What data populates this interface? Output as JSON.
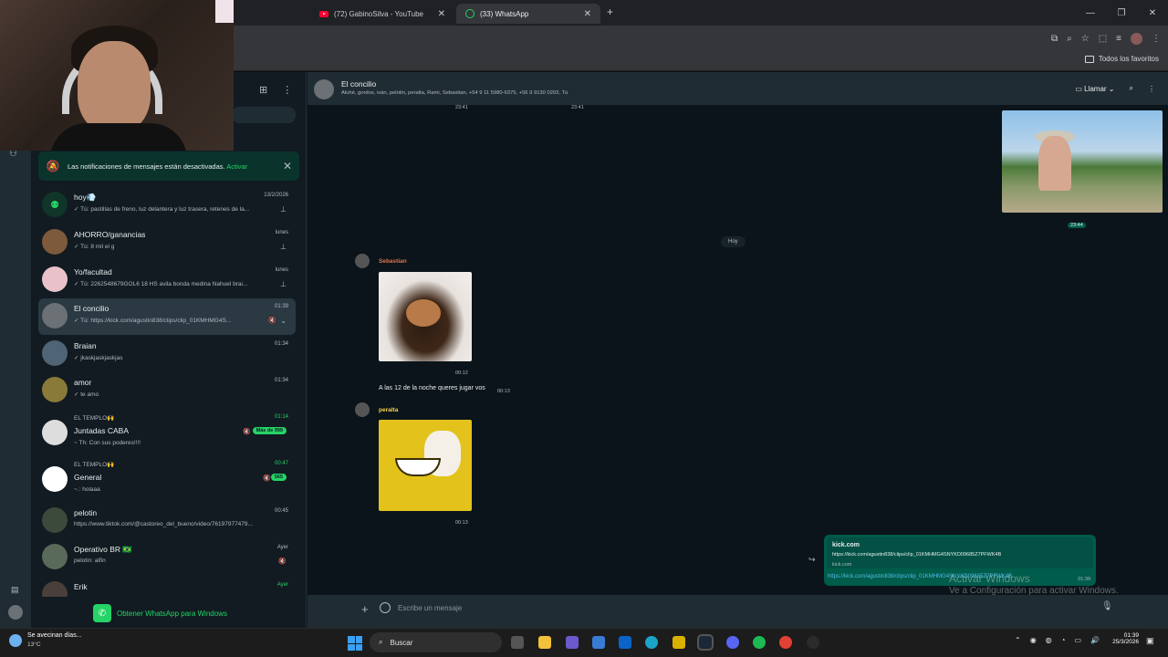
{
  "browser": {
    "tabs": [
      {
        "label": "(72) GabinoSilva - YouTube",
        "icon": "youtube-icon"
      },
      {
        "label": "(33) WhatsApp",
        "icon": "whatsapp-icon"
      }
    ],
    "bookmarks_label": "Todos los favoritos"
  },
  "notification_bar": {
    "text": "Las notificaciones de mensajes están desactivadas.",
    "action": "Activar"
  },
  "chats": [
    {
      "name": "hoy💨",
      "preview": "✓ Tú: pastillas de freno, luz delantera y luz trasera, retenes de la...",
      "time": "13/2/2026"
    },
    {
      "name": "AHORRO/ganancias",
      "preview": "✓ Tú: 8 mil el g",
      "time": "lunes"
    },
    {
      "name": "Yo/facultad",
      "preview": "✓ Tú: 2262548679GOL6 18 HS avila bonda medina  Nahuel  brai...",
      "time": "lunes"
    },
    {
      "name": "El concilio",
      "preview": "✓ Tú: https://kick.com/agustin838/clips/clip_01KMHMG4S...",
      "time": "01:39"
    },
    {
      "name": "Braian",
      "preview": "✓ jkaskjaskjaskjas",
      "time": "01:34"
    },
    {
      "name": "amor",
      "preview": "✓ te amo",
      "time": "01:34"
    },
    {
      "community": "EL TEMPLO🙌",
      "name": "Juntadas CABA",
      "preview": "~ Th: Con sus poderes!!!!",
      "time": "01:14",
      "badge": "Más de 999"
    },
    {
      "community": "EL TEMPLO🙌",
      "name": "General",
      "preview": "~.: holaaa",
      "time": "00:47",
      "badge": "565"
    },
    {
      "name": "pelotin",
      "preview": "https://www.tiktok.com/@castoreo_del_bueno/video/76197977479...",
      "time": "00:45"
    },
    {
      "name": "Operativo BR 🇧🇷",
      "preview": "pelotin: alfin",
      "time": "Ayer"
    },
    {
      "name": "Erik",
      "preview": "",
      "time": "Ayer"
    }
  ],
  "get_app_label": "Obtener WhatsApp para Windows",
  "conversation": {
    "title": "El concilio",
    "members": "Aluhé, gordox, iván, pelotin, peralta, Rami, Sebastian, +54 9 11 5980-6375, +56 9 9130 0203, Tú",
    "call_label": "Llamar",
    "top_times": [
      "23:41",
      "23:41"
    ],
    "photo_time": "23:44",
    "day_chip": "Hoy",
    "sebastian": {
      "sender": "Sebastian",
      "time": "00:12"
    },
    "text_msg": {
      "text": "A las 12 de la noche queres jugar vos",
      "time": "00:13"
    },
    "peralta": {
      "sender": "peralta",
      "time": "00:13"
    },
    "outgoing": {
      "title": "kick.com",
      "url": "https://kick.com/agustin838/clips/clip_01KMHMG4SNYKD09685Z7PFWK4B",
      "domain": "kick.com",
      "link": "https://kick.com/agustin838/clips/clip_01KMHMG4SNYKD09685Z7PFWK4B",
      "time": "01:39"
    },
    "composer_placeholder": "Escribe un mensaje"
  },
  "watermark": {
    "line1": "Activar Windows",
    "line2": "Ve a Configuración para activar Windows."
  },
  "taskbar": {
    "weather_text": "Se avecinan días...",
    "temperature": "13°C",
    "search_label": "Buscar",
    "time": "01:39",
    "date": "25/3/2026"
  },
  "colors": {
    "accent": "#25d366",
    "sender_sebastian": "#e0754d",
    "sender_peralta": "#f7d34a"
  }
}
